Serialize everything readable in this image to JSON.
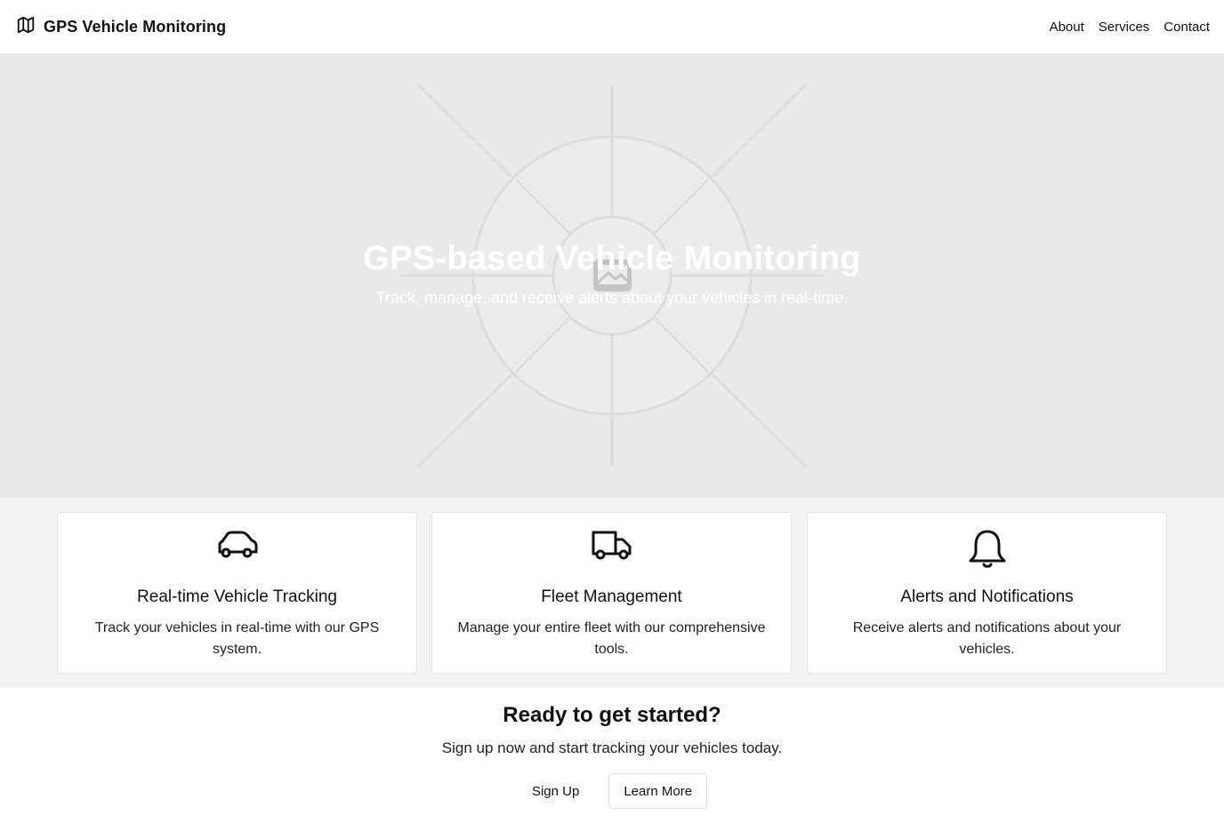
{
  "header": {
    "brand_icon": "map-icon",
    "brand_title": "GPS Vehicle Monitoring",
    "nav": [
      {
        "label": "About"
      },
      {
        "label": "Services"
      },
      {
        "label": "Contact"
      }
    ]
  },
  "hero": {
    "image_icon": "image-placeholder-icon",
    "title": "GPS-based Vehicle Monitoring",
    "subtitle": "Track, manage, and receive alerts about your vehicles in real-time."
  },
  "features": [
    {
      "icon": "car-icon",
      "title": "Real-time Vehicle Tracking",
      "description": "Track your vehicles in real-time with our GPS system."
    },
    {
      "icon": "truck-icon",
      "title": "Fleet Management",
      "description": "Manage your entire fleet with our comprehensive tools."
    },
    {
      "icon": "bell-icon",
      "title": "Alerts and Notifications",
      "description": "Receive alerts and notifications about your vehicles."
    }
  ],
  "cta": {
    "title": "Ready to get started?",
    "subtitle": "Sign up now and start tracking your vehicles today.",
    "primary_label": "Sign Up",
    "secondary_label": "Learn More"
  },
  "colors": {
    "hero_bg": "#e9e9e9",
    "features_bg": "#f2f3f5",
    "text": "#111111"
  }
}
